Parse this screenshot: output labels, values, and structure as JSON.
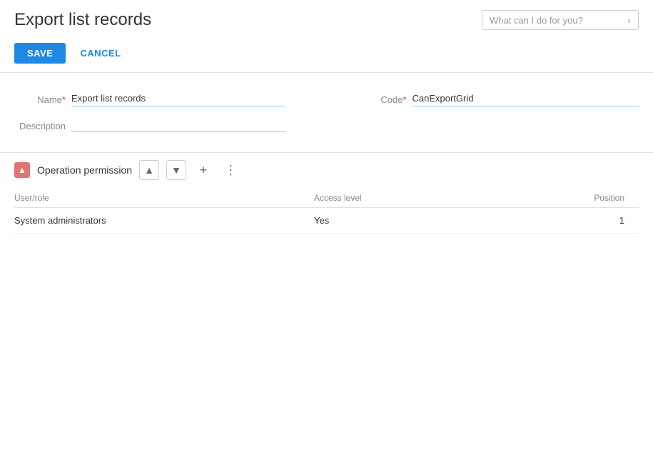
{
  "header": {
    "title": "Export list records",
    "help_placeholder": "What can I do for you?"
  },
  "toolbar": {
    "save_label": "SAVE",
    "cancel_label": "CANCEL"
  },
  "form": {
    "name_label": "Name",
    "name_required": "*",
    "name_value": "Export list records",
    "code_label": "Code",
    "code_required": "*",
    "code_value": "CanExportGrid",
    "description_label": "Description",
    "description_value": ""
  },
  "operation_permission": {
    "section_title": "Operation permission",
    "collapse_icon": "▲",
    "up_icon": "▲",
    "down_icon": "▼",
    "add_icon": "+",
    "more_icon": "⋮",
    "table": {
      "columns": [
        "User/role",
        "Access level",
        "Position"
      ],
      "rows": [
        {
          "user_role": "System administrators",
          "access_level": "Yes",
          "position": "1"
        }
      ]
    }
  }
}
